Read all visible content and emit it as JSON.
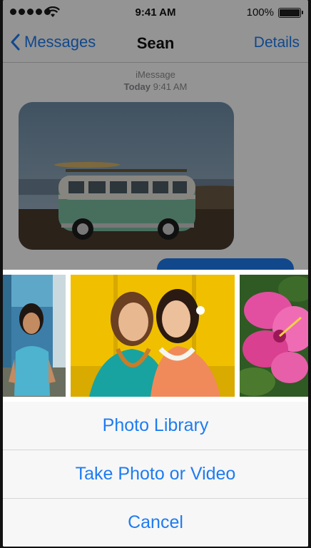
{
  "status_bar": {
    "time": "9:41 AM",
    "battery": "100%",
    "battery_level": 1.0
  },
  "nav": {
    "back_label": "Messages",
    "title": "Sean",
    "details_label": "Details"
  },
  "thread_meta": {
    "service": "iMessage",
    "day": "Today",
    "time": "9:41 AM"
  },
  "attachment_thumbnails": [
    "woman-portrait",
    "two-women-smiling",
    "pink-hibiscus"
  ],
  "action_sheet": {
    "items": [
      "Photo Library",
      "Take Photo or Video"
    ],
    "cancel": "Cancel"
  },
  "colors": {
    "accent": "#1e7cf2",
    "background": "#ffffff",
    "overlay": "#000000"
  },
  "icons": [
    "cellular-signal-icon",
    "wifi-icon",
    "battery-icon",
    "chevron-left-icon"
  ]
}
